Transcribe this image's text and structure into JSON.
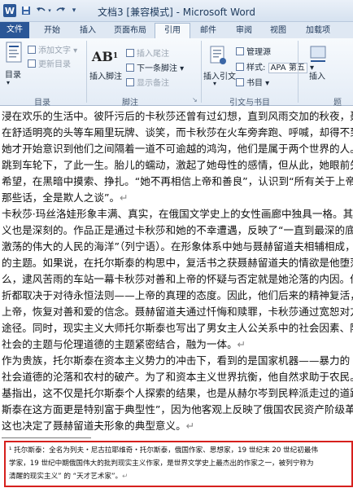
{
  "window": {
    "title": "文档3 [兼容模式] - Microsoft Word",
    "app_icon": "word-logo-icon",
    "quick_access": [
      "save-icon",
      "undo-icon",
      "redo-icon",
      "customize-qat-icon"
    ]
  },
  "tabs": [
    {
      "label": "文件",
      "state": "file"
    },
    {
      "label": "开始",
      "state": ""
    },
    {
      "label": "插入",
      "state": ""
    },
    {
      "label": "页面布局",
      "state": ""
    },
    {
      "label": "引用",
      "state": "active"
    },
    {
      "label": "邮件",
      "state": ""
    },
    {
      "label": "审阅",
      "state": ""
    },
    {
      "label": "视图",
      "state": ""
    },
    {
      "label": "加载项",
      "state": ""
    }
  ],
  "ribbon": {
    "toc": {
      "big_button": "目录",
      "add_text": "添加文字",
      "update_toc": "更新目录",
      "group_label": "目录"
    },
    "footnotes": {
      "insert_footnote": "插入脚注",
      "insert_endnote": "插入尾注",
      "next_footnote": "下一条脚注",
      "show_notes": "显示备注",
      "group_label": "脚注"
    },
    "citations": {
      "insert_citation": "插入引文",
      "manage_sources": "管理源",
      "style_label": "样式:",
      "style_value": "APA 第五",
      "bibliography": "书目",
      "group_label": "引文与书目"
    },
    "captions": {
      "insert_caption": "插入",
      "group_label": "题"
    },
    "accent_color": "#2b5797",
    "highlight_color": "#d6201d"
  },
  "document": {
    "lines": [
      "浸在欢乐的生活中。彼阡污后的卡秋莎还曾有过幻想，直到风雨交加的秋夜，聂赫留多",
      "在舒适明亮的头等车厢里玩牌、谈笑，而卡秋莎在火车旁奔跑、呼喊，却得不到回音，",
      "她才开始意识到他们之间隔着一道不可逾越的鸿沟，他们是属于两个世界的人。她真",
      "跳到车轮下，了此一生。胎儿的蠕动，激起了她母性的感情，但从此，她眼前失去了",
      "希望，在黑暗中摸索、挣扎。“她不再相信上帝和善良”，认识到“所有关于上帝和关",
      "那些话，全是欺人之谈”。",
      "    卡秋莎·玛丝洛娃形象丰满、真实，在俄国文学史上的女性画廊中独具一格。其",
      "义也是深刻的。作品正是通过卡秋莎和她的不幸遭遇，反映了“一直到最深的底层都",
      "激荡的伟大的人民的海洋”（列宁语）。在形象体系中她与聂赫留道夫相辅相成，体现",
      "的主题。如果说，在托尔斯泰的构思中，复活书之获聂赫留道夫的情欲是他堕落的开",
      "么，逮风苦雨的车站一幕卡秋莎对善和上帝的怀疑与否定就是她沦落的内因。他们生",
      "折都取决于对待永恒法则——上帝的真理的态度。因此，他们后来的精神复活，首先",
      "上帝，恢复对善和爱的信念。聂赫留道夫通过忏悔和赎罪，卡秋莎通过宽恕对方，恢",
      "途径。同时，现实主义大师托尔斯泰也写出了男女主人公关系中的社会因素、阶级对",
      "社会的主题与伦理道德的主题紧密结合，融为一体。",
      "    作为贵族，托尔斯泰在资本主义势力的冲击下，看到的是国家机器——暴力的",
      "社会道德的沦落和农村的破产。为了和资本主义世界抗衡，他自然求助于农民。卢那",
      "基指出，这不仅是托尔斯泰个人探索的结果，也是从赫尔岑到民粹派走过的道路，而",
      "斯泰在这方面更是特别富于典型性”，因为他客观上反映了俄国农民资产阶级革命的",
      "这也决定了聂赫留道夫形象的典型意义。"
    ],
    "paragraph_mark": "↵",
    "footnote": {
      "lines": [
        "¹ 托尔斯泰：全名为列夫・尼古拉耶维奇・托尔斯泰，俄国作家、思想家，19 世纪末 20 世纪初最伟",
        "学家，19 世纪中期俄国伟大的批判现实主义作家，是世界文学史上最杰出的作家之一，被列宁称为",
        "清醒的现实主义” 的 “天才艺术家”。"
      ]
    }
  }
}
